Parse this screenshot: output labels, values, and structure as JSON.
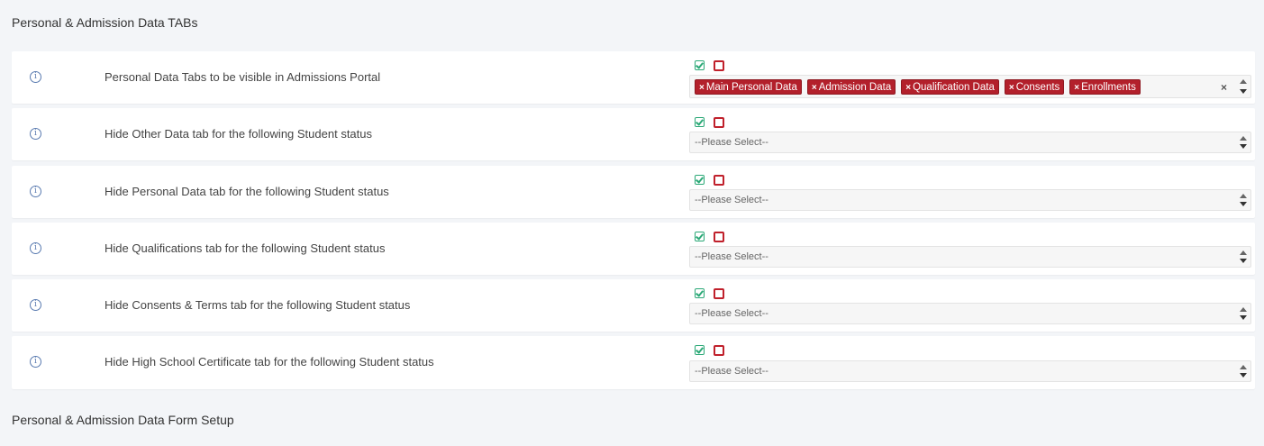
{
  "sections": {
    "tabs_title": "Personal & Admission Data TABs",
    "form_title": "Personal & Admission Data Form Setup"
  },
  "info_glyph": "i",
  "clear_glyph": "×",
  "tag_remove_glyph": "×",
  "rows": [
    {
      "label": "Personal Data Tabs to be visible in Admissions Portal",
      "tags": [
        "Main Personal Data",
        "Admission Data",
        "Qualification Data",
        "Consents",
        "Enrollments"
      ]
    },
    {
      "label": "Hide Other Data tab for the following Student status",
      "placeholder": "--Please Select--"
    },
    {
      "label": "Hide Personal Data tab for the following Student status",
      "placeholder": "--Please Select--"
    },
    {
      "label": "Hide Qualifications tab for the following Student status",
      "placeholder": "--Please Select--"
    },
    {
      "label": "Hide Consents & Terms tab for the following Student status",
      "placeholder": "--Please Select--"
    },
    {
      "label": "Hide High School Certificate tab for the following Student status",
      "placeholder": "--Please Select--"
    }
  ],
  "colors": {
    "tag_bg": "#b3202b",
    "check": "#2aa876",
    "uncheck": "#c0202b",
    "info": "#5a7bb0"
  },
  "icons": [
    "info-icon",
    "check-all-icon",
    "uncheck-all-icon",
    "remove-tag-icon",
    "clear-icon",
    "spinner-up-icon",
    "spinner-down-icon"
  ]
}
